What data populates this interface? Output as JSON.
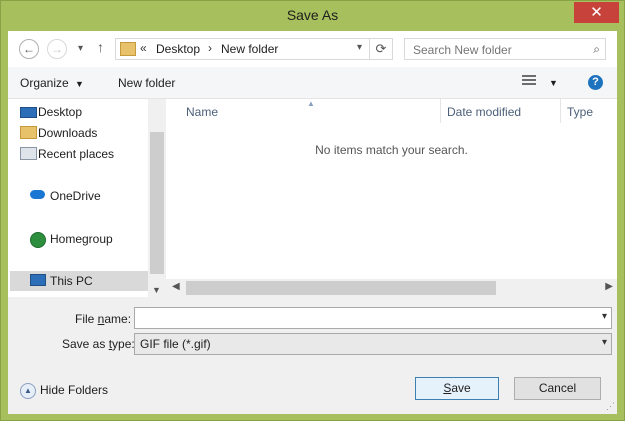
{
  "window": {
    "title": "Save As",
    "close_glyph": "✕"
  },
  "nav": {
    "back_glyph": "←",
    "forward_glyph": "→",
    "recent_glyph": "▾",
    "up_glyph": "↑",
    "breadcrumb_prefix": "«",
    "breadcrumb": [
      "Desktop",
      "New folder"
    ],
    "crumb_sep": "›",
    "refresh_glyph": "⟳",
    "search_placeholder": "Search New folder"
  },
  "toolbar": {
    "organize_label": "Organize",
    "new_folder_label": "New folder",
    "help_glyph": "?"
  },
  "nav_pane": {
    "items": [
      {
        "label": "Desktop",
        "icon": "desktop-icon"
      },
      {
        "label": "Downloads",
        "icon": "downloads-folder-icon"
      },
      {
        "label": "Recent places",
        "icon": "recent-places-icon"
      },
      {
        "label": "OneDrive",
        "icon": "onedrive-cloud-icon"
      },
      {
        "label": "Homegroup",
        "icon": "homegroup-icon"
      },
      {
        "label": "This PC",
        "icon": "computer-icon"
      }
    ]
  },
  "file_list": {
    "columns": [
      "Name",
      "Date modified",
      "Type"
    ],
    "empty_message": "No items match your search."
  },
  "form": {
    "file_name_label_pre": "File ",
    "file_name_label_accel": "n",
    "file_name_label_post": "ame:",
    "file_name_value": "",
    "save_type_label_pre": "Save as ",
    "save_type_label_accel": "t",
    "save_type_label_post": "ype:",
    "save_type_value": "GIF file (*.gif)"
  },
  "footer": {
    "hide_folders_label": "Hide Folders",
    "save_label_accel": "S",
    "save_label_rest": "ave",
    "cancel_label": "Cancel"
  },
  "colors": {
    "frame": "#a7bf5c",
    "close": "#c7423b",
    "header_text": "#4c607a"
  }
}
